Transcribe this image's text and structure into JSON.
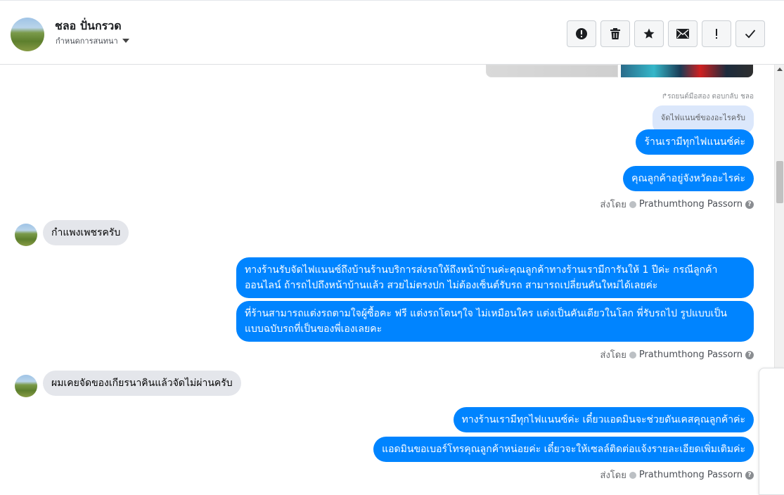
{
  "header": {
    "contact_name": "ชลอ ปั่นกรวด",
    "label_select": "กำหนดการสนทนา",
    "toolbar": [
      {
        "name": "mark-spam-button",
        "icon": "alert-circle-icon"
      },
      {
        "name": "delete-button",
        "icon": "trash-icon"
      },
      {
        "name": "star-button",
        "icon": "star-icon"
      },
      {
        "name": "mark-unread-button",
        "icon": "envelope-icon"
      },
      {
        "name": "follow-up-button",
        "icon": "exclamation-icon"
      },
      {
        "name": "mark-done-button",
        "icon": "check-icon"
      }
    ]
  },
  "thread": {
    "reply_note": "รถยนต์มือสอง ตอบกลับ ชลอ",
    "quoted_text": "จัดไฟแนนซ์ของอะไรครับ",
    "messages": [
      {
        "from": "page",
        "text": "ร้านเรามีทุกไฟแนนซ์ค่ะ"
      },
      {
        "from": "page",
        "text": "คุณลูกค้าอยู่จังหวัดอะไรค่ะ"
      },
      {
        "from": "customer",
        "text": "กำแพงเพชรครับ"
      },
      {
        "from": "page",
        "text": "ทางร้านรับจัดไฟแนนซ์ถึงบ้านร้านบริการส่งรถให้ถึงหน้าบ้านค่ะคุณลูกค้าทางร้านเรามีการันให้ 1 ปีค่ะ กรณีลูกค้าออนไลน์ ถ้ารถไปถึงหน้าบ้านแล้ว สวยไม่ตรงปก ไม่ต้องเซ็นต์รับรถ สามารถเปลี่ยนคันใหม่ได้เลยค่ะ"
      },
      {
        "from": "page",
        "text": "ที่ร้านสามารถแต่งรถตามใจผู้ซื้อคะ ฟรี แต่งรถโดนๆใจ ไม่เหมือนใคร แต่งเป็นคันเดียวในโลก พี่รับรถไป รูปแบบเป็นแบบฉบับรถที่เป็นของพี่เองเลยคะ"
      },
      {
        "from": "customer",
        "text": "ผมเคยจัดของเกียรนาคินแล้วจัดไม่ผ่านครับ"
      },
      {
        "from": "page",
        "text": "ทางร้านเรามีทุกไฟแนนซ์ค่ะ เดี๋ยวแอดมินจะช่วยดันเคสคุณลูกค้าค่ะ"
      },
      {
        "from": "page",
        "text": "แอดมินขอเบอร์โทรคุณลูกค้าหน่อยค่ะ  เดี๋ยวจะให้เซลล์ติดต่อแจ้งรายละเอียดเพิ่มเติมค่ะ"
      }
    ],
    "sent_by_label": "ส่งโดย",
    "sender_name": "Prathumthong Passorn"
  },
  "colors": {
    "outgoing_bubble": "#0084ff",
    "incoming_bubble": "#e4e6eb"
  }
}
